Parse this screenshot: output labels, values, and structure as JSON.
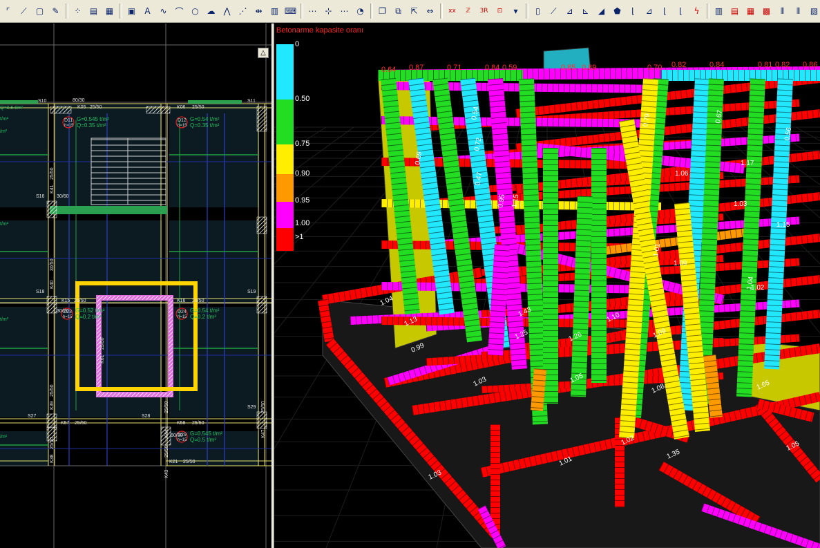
{
  "toolbar": {
    "buttons": [
      {
        "icon": "select-icon",
        "glyph": "⌜"
      },
      {
        "icon": "polyline-icon",
        "glyph": "⟋"
      },
      {
        "icon": "window-icon",
        "glyph": "▢"
      },
      {
        "icon": "wand-icon",
        "glyph": "✎"
      },
      {
        "sep": true
      },
      {
        "icon": "grid-dots-icon",
        "glyph": "⁘"
      },
      {
        "icon": "calculator-icon",
        "glyph": "▤"
      },
      {
        "icon": "grid-icon",
        "glyph": "▦"
      },
      {
        "sep": true
      },
      {
        "icon": "image-icon",
        "glyph": "▣"
      },
      {
        "icon": "text-icon",
        "glyph": "A"
      },
      {
        "icon": "spline-icon",
        "glyph": "∿"
      },
      {
        "icon": "arc-icon",
        "glyph": "⌒"
      },
      {
        "icon": "circle-icon",
        "glyph": "○"
      },
      {
        "icon": "cloud-icon",
        "glyph": "☁"
      },
      {
        "icon": "zigzag-icon",
        "glyph": "⋀"
      },
      {
        "icon": "hatch-icon",
        "glyph": "⋰"
      },
      {
        "icon": "dimension-icon",
        "glyph": "⇹"
      },
      {
        "icon": "chart-icon",
        "glyph": "▥"
      },
      {
        "icon": "keyboard-icon",
        "glyph": "⌨"
      },
      {
        "sep": true
      },
      {
        "icon": "snap-line-icon",
        "glyph": "⋯"
      },
      {
        "icon": "snap-node-icon",
        "glyph": "⊹"
      },
      {
        "icon": "snap-mid-icon",
        "glyph": "⋯"
      },
      {
        "icon": "snap-camera-icon",
        "glyph": "◔"
      },
      {
        "sep": true
      },
      {
        "icon": "copy-icon",
        "glyph": "❐"
      },
      {
        "icon": "layer-icon",
        "glyph": "⧉"
      },
      {
        "icon": "move-icon",
        "glyph": "⇱"
      },
      {
        "icon": "mirror-icon",
        "glyph": "⇔"
      },
      {
        "sep": true
      },
      {
        "icon": "dim-xx-icon",
        "glyph": "xx"
      },
      {
        "icon": "dim-zz-icon",
        "glyph": "ℤ"
      },
      {
        "icon": "dim-3r-icon",
        "glyph": "3R"
      },
      {
        "icon": "dim-view-icon",
        "glyph": "⊡"
      },
      {
        "icon": "dropdown-arrow-icon",
        "glyph": "▾"
      },
      {
        "sep": true
      },
      {
        "icon": "column-icon",
        "glyph": "▯"
      },
      {
        "icon": "beam-icon",
        "glyph": "⟋"
      },
      {
        "icon": "ruler-icon",
        "glyph": "⊿"
      },
      {
        "icon": "stair-icon",
        "glyph": "⊾"
      },
      {
        "icon": "slab-icon",
        "glyph": "◢"
      },
      {
        "icon": "shell-icon",
        "glyph": "⬟"
      },
      {
        "icon": "axis-icon",
        "glyph": "⌊"
      },
      {
        "icon": "load-icon",
        "glyph": "⊿"
      },
      {
        "icon": "axis2-icon",
        "glyph": "⌊"
      },
      {
        "icon": "graph-icon",
        "glyph": "⌊"
      },
      {
        "icon": "lightning-icon",
        "glyph": "ϟ"
      },
      {
        "sep": true
      },
      {
        "icon": "report-icon",
        "glyph": "▥"
      },
      {
        "icon": "table-icon",
        "glyph": "▤"
      },
      {
        "icon": "table2-icon",
        "glyph": "▦"
      },
      {
        "icon": "table3-icon",
        "glyph": "▩"
      },
      {
        "icon": "columns-icon",
        "glyph": "⦀"
      },
      {
        "icon": "columns2-icon",
        "glyph": "⦀"
      },
      {
        "icon": "print-icon",
        "glyph": "▧"
      },
      {
        "icon": "pencil-icon",
        "glyph": "✐"
      }
    ]
  },
  "plan": {
    "collapse_label": "△",
    "slabs": [
      {
        "name": "D11",
        "load1": "G=0.545 t/m²",
        "load2": "Q=0.35 t/m²",
        "h": "h=15"
      },
      {
        "name": "D12",
        "load1": "G=0.54  t/m²",
        "load2": "Q=0.35 t/m²",
        "h": "h=15"
      },
      {
        "name": "D23",
        "load1": "G=0.52 t/m²",
        "load2": "Q=0.2 t/m²",
        "h": "h=15"
      },
      {
        "name": "D24",
        "load1": "G=0.54 t/m²",
        "load2": "Q=0.2 t/m²",
        "h": "h=15"
      },
      {
        "name": "D29",
        "load1": "G=0.545 t/m²",
        "load2": "Q=0.5 t/m²",
        "h": "h=15"
      }
    ],
    "labels": [
      "S10",
      "80/30",
      "S11",
      "K05",
      "25/50",
      "K06",
      "25/50",
      "30/60",
      "S16",
      "S18",
      "K15",
      "25/50",
      "K16",
      "25/50",
      "S19",
      "30/70",
      "S27",
      "S28",
      "K57",
      "25/50",
      "K58",
      "25/50",
      "S29",
      "60/30",
      "K21",
      "25/50",
      "K41",
      "25/50",
      "K40",
      "30/50",
      "K39",
      "25/50",
      "K44",
      "25/50",
      "K47",
      "25/50",
      "K38",
      "25/50",
      "K43",
      "25/50",
      "K61",
      "25/50",
      "Q=0.5 t/m²",
      "t/m²",
      "/m²",
      "t/m²",
      "t/m²",
      "/m²"
    ]
  },
  "legend": {
    "title": "Betonarme kapasite oranı",
    "labels": [
      "0",
      "0.50",
      "0.75",
      "0.90",
      "0.95",
      "1.00",
      ">1"
    ],
    "colors": [
      "#22e8ff",
      "#22dd22",
      "#ffee00",
      "#ff9900",
      "#ff00ff",
      "#ff0000"
    ]
  },
  "model_values": [
    "0.64",
    "0.87",
    "0.71",
    "0.84",
    "0.59",
    "0.85",
    "0.89",
    "0.70",
    "0.82",
    "0.84",
    "0.81",
    "0.82",
    "0.86",
    "1.06",
    "1.17",
    "1.03",
    "1.15",
    "1.09",
    "1.02",
    "1.04",
    "1.13",
    "1.43",
    "1.25",
    "1.26",
    "1.05",
    "1.10",
    "1.09",
    "0.99",
    "1.03",
    "1.08",
    "1.02",
    "1.01",
    "1.35",
    "1.05",
    "1.03",
    "1.65",
    "0.79",
    "0.54",
    "0.72",
    "0.47",
    "0.69",
    "0.67",
    "0.56",
    "0.95",
    "1.15",
    "1.01",
    "1.04"
  ]
}
